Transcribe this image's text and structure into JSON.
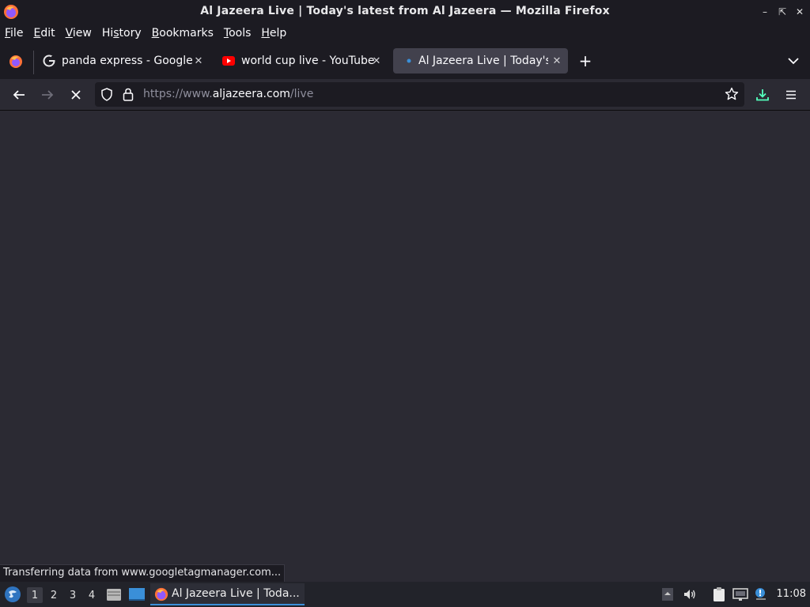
{
  "window": {
    "title": "Al Jazeera Live | Today's latest from Al Jazeera — Mozilla Firefox",
    "controls": [
      "minimize-icon",
      "maximize-icon",
      "close-icon"
    ]
  },
  "menubar": {
    "items": [
      {
        "label": "File",
        "accel": "F"
      },
      {
        "label": "Edit",
        "accel": "E"
      },
      {
        "label": "View",
        "accel": "V"
      },
      {
        "label": "History",
        "accel": "s"
      },
      {
        "label": "Bookmarks",
        "accel": "B"
      },
      {
        "label": "Tools",
        "accel": "T"
      },
      {
        "label": "Help",
        "accel": "H"
      }
    ]
  },
  "tabs": [
    {
      "label": "panda express - Google S",
      "icon": "google-icon",
      "active": false
    },
    {
      "label": "world cup live - YouTube",
      "icon": "youtube-icon",
      "active": false
    },
    {
      "label": "Al Jazeera Live | Today's l",
      "icon": "loading-dot-icon",
      "active": true
    }
  ],
  "navbar": {
    "url_prefix": "https://www.",
    "url_host": "aljazeera.com",
    "url_path": "/live"
  },
  "status": {
    "text": "Transferring data from www.googletagmanager.com..."
  },
  "taskbar": {
    "workspaces": [
      "1",
      "2",
      "3",
      "4"
    ],
    "active_workspace": "1",
    "window_label": "Al Jazeera Live | Toda...",
    "clock": "11:08"
  },
  "colors": {
    "accent": "#3a8fd8",
    "download": "#54ffbd",
    "chrome_bg": "#1c1b22",
    "toolbar_bg": "#2b2a33"
  }
}
